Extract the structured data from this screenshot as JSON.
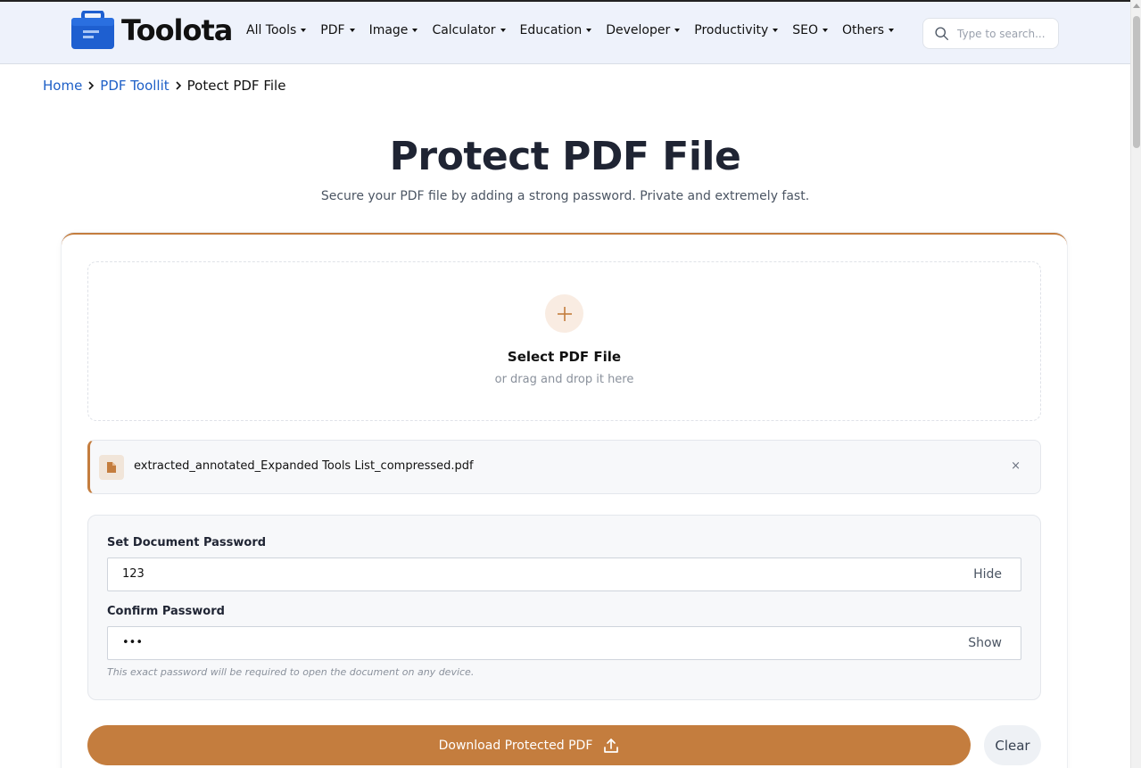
{
  "header": {
    "logo_text": "Toolota",
    "nav": [
      "All Tools",
      "PDF",
      "Image",
      "Calculator",
      "Education",
      "Developer",
      "Productivity",
      "SEO",
      "Others"
    ],
    "search_placeholder": "Type to search..."
  },
  "breadcrumb": {
    "home": "Home",
    "section": "PDF Toollit",
    "current": "Potect PDF File"
  },
  "page": {
    "title": "Protect PDF File",
    "subtitle": "Secure your PDF file by adding a strong password. Private and extremely fast."
  },
  "dropzone": {
    "title": "Select PDF File",
    "subtitle": "or drag and drop it here"
  },
  "file": {
    "name": "extracted_annotated_Expanded Tools List_compressed.pdf",
    "close": "×"
  },
  "password": {
    "set_label": "Set Document Password",
    "set_value": "123",
    "set_toggle": "Hide",
    "confirm_label": "Confirm Password",
    "confirm_value": "•••",
    "confirm_toggle": "Show",
    "hint": "This exact password will be required to open the document on any device."
  },
  "actions": {
    "download": "Download Protected PDF",
    "clear": "Clear"
  },
  "colors": {
    "accent": "#c47d3e",
    "link": "#1d5fc7",
    "logo_blue": "#1e5fd0"
  }
}
